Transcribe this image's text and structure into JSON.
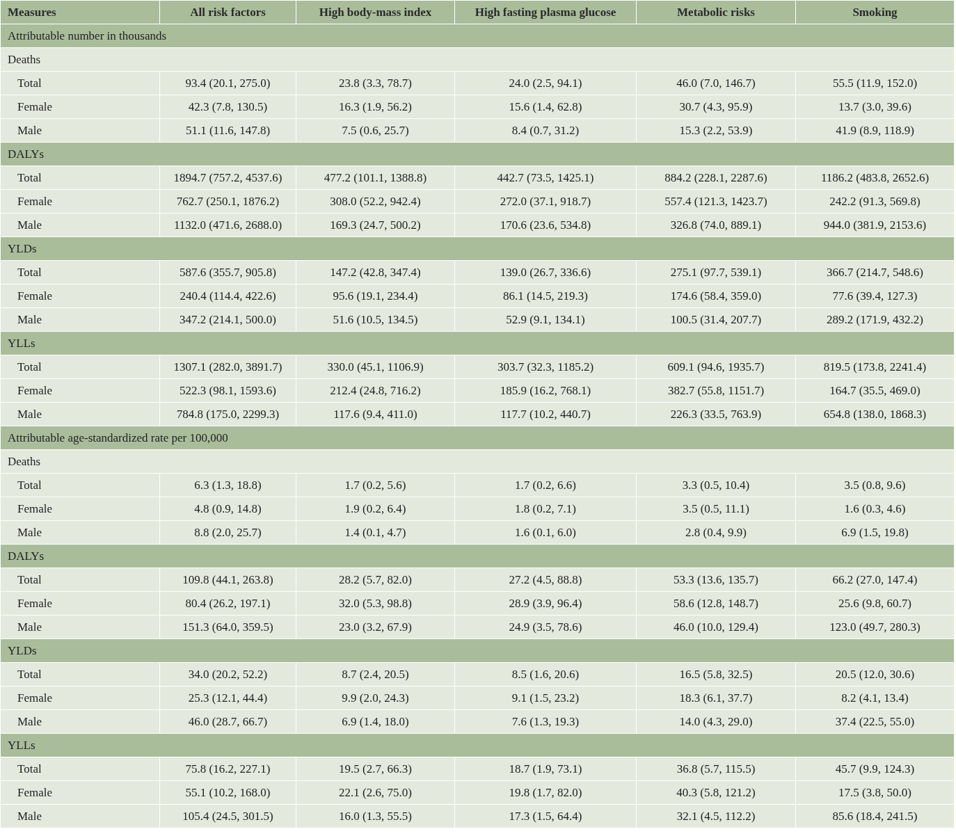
{
  "table": {
    "columns": [
      "Measures",
      "All risk factors",
      "High body-mass index",
      "High fasting plasma glucose",
      "Metabolic risks",
      "Smoking"
    ],
    "rows": [
      {
        "kind": "heading",
        "label": "Attributable number in thousands",
        "highlighted": true
      },
      {
        "kind": "heading",
        "label": "Deaths",
        "highlighted": false
      },
      {
        "kind": "data",
        "cells": [
          "Total",
          "93.4 (20.1, 275.0)",
          "23.8 (3.3, 78.7)",
          "24.0 (2.5, 94.1)",
          "46.0 (7.0, 146.7)",
          "55.5 (11.9, 152.0)"
        ]
      },
      {
        "kind": "data",
        "cells": [
          "Female",
          "42.3 (7.8, 130.5)",
          "16.3 (1.9, 56.2)",
          "15.6 (1.4, 62.8)",
          "30.7 (4.3, 95.9)",
          "13.7 (3.0, 39.6)"
        ]
      },
      {
        "kind": "data",
        "cells": [
          "Male",
          "51.1 (11.6, 147.8)",
          "7.5 (0.6, 25.7)",
          "8.4 (0.7, 31.2)",
          "15.3 (2.2, 53.9)",
          "41.9 (8.9, 118.9)"
        ]
      },
      {
        "kind": "heading",
        "label": "DALYs",
        "highlighted": true
      },
      {
        "kind": "data",
        "cells": [
          "Total",
          "1894.7 (757.2, 4537.6)",
          "477.2 (101.1, 1388.8)",
          "442.7 (73.5, 1425.1)",
          "884.2 (228.1, 2287.6)",
          "1186.2 (483.8, 2652.6)"
        ]
      },
      {
        "kind": "data",
        "cells": [
          "Female",
          "762.7 (250.1, 1876.2)",
          "308.0 (52.2, 942.4)",
          "272.0 (37.1, 918.7)",
          "557.4 (121.3, 1423.7)",
          "242.2 (91.3, 569.8)"
        ]
      },
      {
        "kind": "data",
        "cells": [
          "Male",
          "1132.0 (471.6, 2688.0)",
          "169.3 (24.7, 500.2)",
          "170.6 (23.6, 534.8)",
          "326.8 (74.0, 889.1)",
          "944.0 (381.9, 2153.6)"
        ]
      },
      {
        "kind": "heading",
        "label": "YLDs",
        "highlighted": true
      },
      {
        "kind": "data",
        "cells": [
          "Total",
          "587.6 (355.7, 905.8)",
          "147.2 (42.8, 347.4)",
          "139.0 (26.7, 336.6)",
          "275.1 (97.7, 539.1)",
          "366.7 (214.7, 548.6)"
        ]
      },
      {
        "kind": "data",
        "cells": [
          "Female",
          "240.4 (114.4, 422.6)",
          "95.6 (19.1, 234.4)",
          "86.1 (14.5, 219.3)",
          "174.6 (58.4, 359.0)",
          "77.6 (39.4, 127.3)"
        ]
      },
      {
        "kind": "data",
        "cells": [
          "Male",
          "347.2 (214.1, 500.0)",
          "51.6 (10.5, 134.5)",
          "52.9 (9.1, 134.1)",
          "100.5 (31.4, 207.7)",
          "289.2 (171.9, 432.2)"
        ]
      },
      {
        "kind": "heading",
        "label": "YLLs",
        "highlighted": true
      },
      {
        "kind": "data",
        "cells": [
          "Total",
          "1307.1 (282.0, 3891.7)",
          "330.0 (45.1, 1106.9)",
          "303.7 (32.3, 1185.2)",
          "609.1 (94.6, 1935.7)",
          "819.5 (173.8, 2241.4)"
        ]
      },
      {
        "kind": "data",
        "cells": [
          "Female",
          "522.3 (98.1, 1593.6)",
          "212.4 (24.8, 716.2)",
          "185.9 (16.2, 768.1)",
          "382.7 (55.8, 1151.7)",
          "164.7 (35.5, 469.0)"
        ]
      },
      {
        "kind": "data",
        "cells": [
          "Male",
          "784.8 (175.0, 2299.3)",
          "117.6 (9.4, 411.0)",
          "117.7 (10.2, 440.7)",
          "226.3 (33.5, 763.9)",
          "654.8 (138.0, 1868.3)"
        ]
      },
      {
        "kind": "heading",
        "label": "Attributable age-standardized rate per 100,000",
        "highlighted": true
      },
      {
        "kind": "heading",
        "label": "Deaths",
        "highlighted": false
      },
      {
        "kind": "data",
        "cells": [
          "Total",
          "6.3 (1.3, 18.8)",
          "1.7 (0.2, 5.6)",
          "1.7 (0.2, 6.6)",
          "3.3 (0.5, 10.4)",
          "3.5 (0.8, 9.6)"
        ]
      },
      {
        "kind": "data",
        "cells": [
          "Female",
          "4.8 (0.9, 14.8)",
          "1.9 (0.2, 6.4)",
          "1.8 (0.2, 7.1)",
          "3.5 (0.5, 11.1)",
          "1.6 (0.3, 4.6)"
        ]
      },
      {
        "kind": "data",
        "cells": [
          "Male",
          "8.8 (2.0, 25.7)",
          "1.4 (0.1, 4.7)",
          "1.6 (0.1, 6.0)",
          "2.8 (0.4, 9.9)",
          "6.9 (1.5, 19.8)"
        ]
      },
      {
        "kind": "heading",
        "label": "DALYs",
        "highlighted": true
      },
      {
        "kind": "data",
        "cells": [
          "Total",
          "109.8 (44.1, 263.8)",
          "28.2 (5.7, 82.0)",
          "27.2 (4.5, 88.8)",
          "53.3 (13.6, 135.7)",
          "66.2 (27.0, 147.4)"
        ]
      },
      {
        "kind": "data",
        "cells": [
          "Female",
          "80.4 (26.2, 197.1)",
          "32.0 (5.3, 98.8)",
          "28.9 (3.9, 96.4)",
          "58.6 (12.8, 148.7)",
          "25.6 (9.8, 60.7)"
        ]
      },
      {
        "kind": "data",
        "cells": [
          "Male",
          "151.3 (64.0, 359.5)",
          "23.0 (3.2, 67.9)",
          "24.9 (3.5, 78.6)",
          "46.0 (10.0, 129.4)",
          "123.0 (49.7, 280.3)"
        ]
      },
      {
        "kind": "heading",
        "label": "YLDs",
        "highlighted": true
      },
      {
        "kind": "data",
        "cells": [
          "Total",
          "34.0 (20.2, 52.2)",
          "8.7 (2.4, 20.5)",
          "8.5 (1.6, 20.6)",
          "16.5 (5.8, 32.5)",
          "20.5 (12.0, 30.6)"
        ]
      },
      {
        "kind": "data",
        "cells": [
          "Female",
          "25.3 (12.1, 44.4)",
          "9.9 (2.0, 24.3)",
          "9.1 (1.5, 23.2)",
          "18.3 (6.1, 37.7)",
          "8.2 (4.1, 13.4)"
        ]
      },
      {
        "kind": "data",
        "cells": [
          "Male",
          "46.0 (28.7, 66.7)",
          "6.9 (1.4, 18.0)",
          "7.6 (1.3, 19.3)",
          "14.0 (4.3, 29.0)",
          "37.4 (22.5, 55.0)"
        ]
      },
      {
        "kind": "heading",
        "label": "YLLs",
        "highlighted": true
      },
      {
        "kind": "data",
        "cells": [
          "Total",
          "75.8 (16.2, 227.1)",
          "19.5 (2.7, 66.3)",
          "18.7 (1.9, 73.1)",
          "36.8 (5.7, 115.5)",
          "45.7 (9.9, 124.3)"
        ]
      },
      {
        "kind": "data",
        "cells": [
          "Female",
          "55.1 (10.2, 168.0)",
          "22.1 (2.6, 75.0)",
          "19.8 (1.7, 82.0)",
          "40.3 (5.8, 121.2)",
          "17.5 (3.8, 50.0)"
        ]
      },
      {
        "kind": "data",
        "cells": [
          "Male",
          "105.4 (24.5, 301.5)",
          "16.0 (1.3, 55.5)",
          "17.3 (1.5, 64.4)",
          "32.1 (4.5, 112.2)",
          "85.6 (18.4, 241.5)"
        ]
      }
    ]
  }
}
